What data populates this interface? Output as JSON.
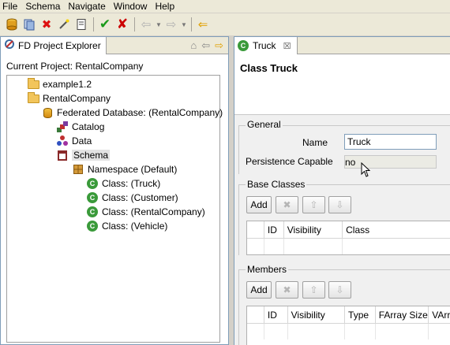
{
  "menu": [
    "File",
    "Schema",
    "Navigate",
    "Window",
    "Help"
  ],
  "left_panel": {
    "tab_label": "FD Project Explorer",
    "current_project_label": "Current Project: RentalCompany",
    "tree": [
      {
        "label": "example1.2",
        "icon": "folder-icon"
      },
      {
        "label": "RentalCompany",
        "icon": "folder-icon"
      },
      {
        "label": "Federated Database: (RentalCompany)",
        "icon": "database-icon"
      },
      {
        "label": "Catalog",
        "icon": "catalog-icon"
      },
      {
        "label": "Data",
        "icon": "data-icon"
      },
      {
        "label": "Schema",
        "icon": "schema-icon"
      },
      {
        "label": "Namespace (Default)",
        "icon": "namespace-icon"
      },
      {
        "label": "Class: (Truck)",
        "icon": "class-icon"
      },
      {
        "label": "Class: (Customer)",
        "icon": "class-icon"
      },
      {
        "label": "Class: (RentalCompany)",
        "icon": "class-icon"
      },
      {
        "label": "Class: (Vehicle)",
        "icon": "class-icon"
      }
    ]
  },
  "editor": {
    "tab_label": "Truck",
    "title": "Class Truck",
    "general": {
      "section_title": "General",
      "name_label": "Name",
      "name_value": "Truck",
      "persistence_label": "Persistence Capable",
      "persistence_value": "no"
    },
    "base_classes": {
      "section_title": "Base Classes",
      "add_label": "Add",
      "columns": [
        "",
        "ID",
        "Visibility",
        "Class"
      ]
    },
    "members": {
      "section_title": "Members",
      "add_label": "Add",
      "columns": [
        "",
        "ID",
        "Visibility",
        "Type",
        "FArray Size",
        "VArr"
      ]
    }
  },
  "colors": {
    "accent_green": "#3a9a3a",
    "selection": "#e3e3e3",
    "border_blue": "#7f9db9"
  }
}
